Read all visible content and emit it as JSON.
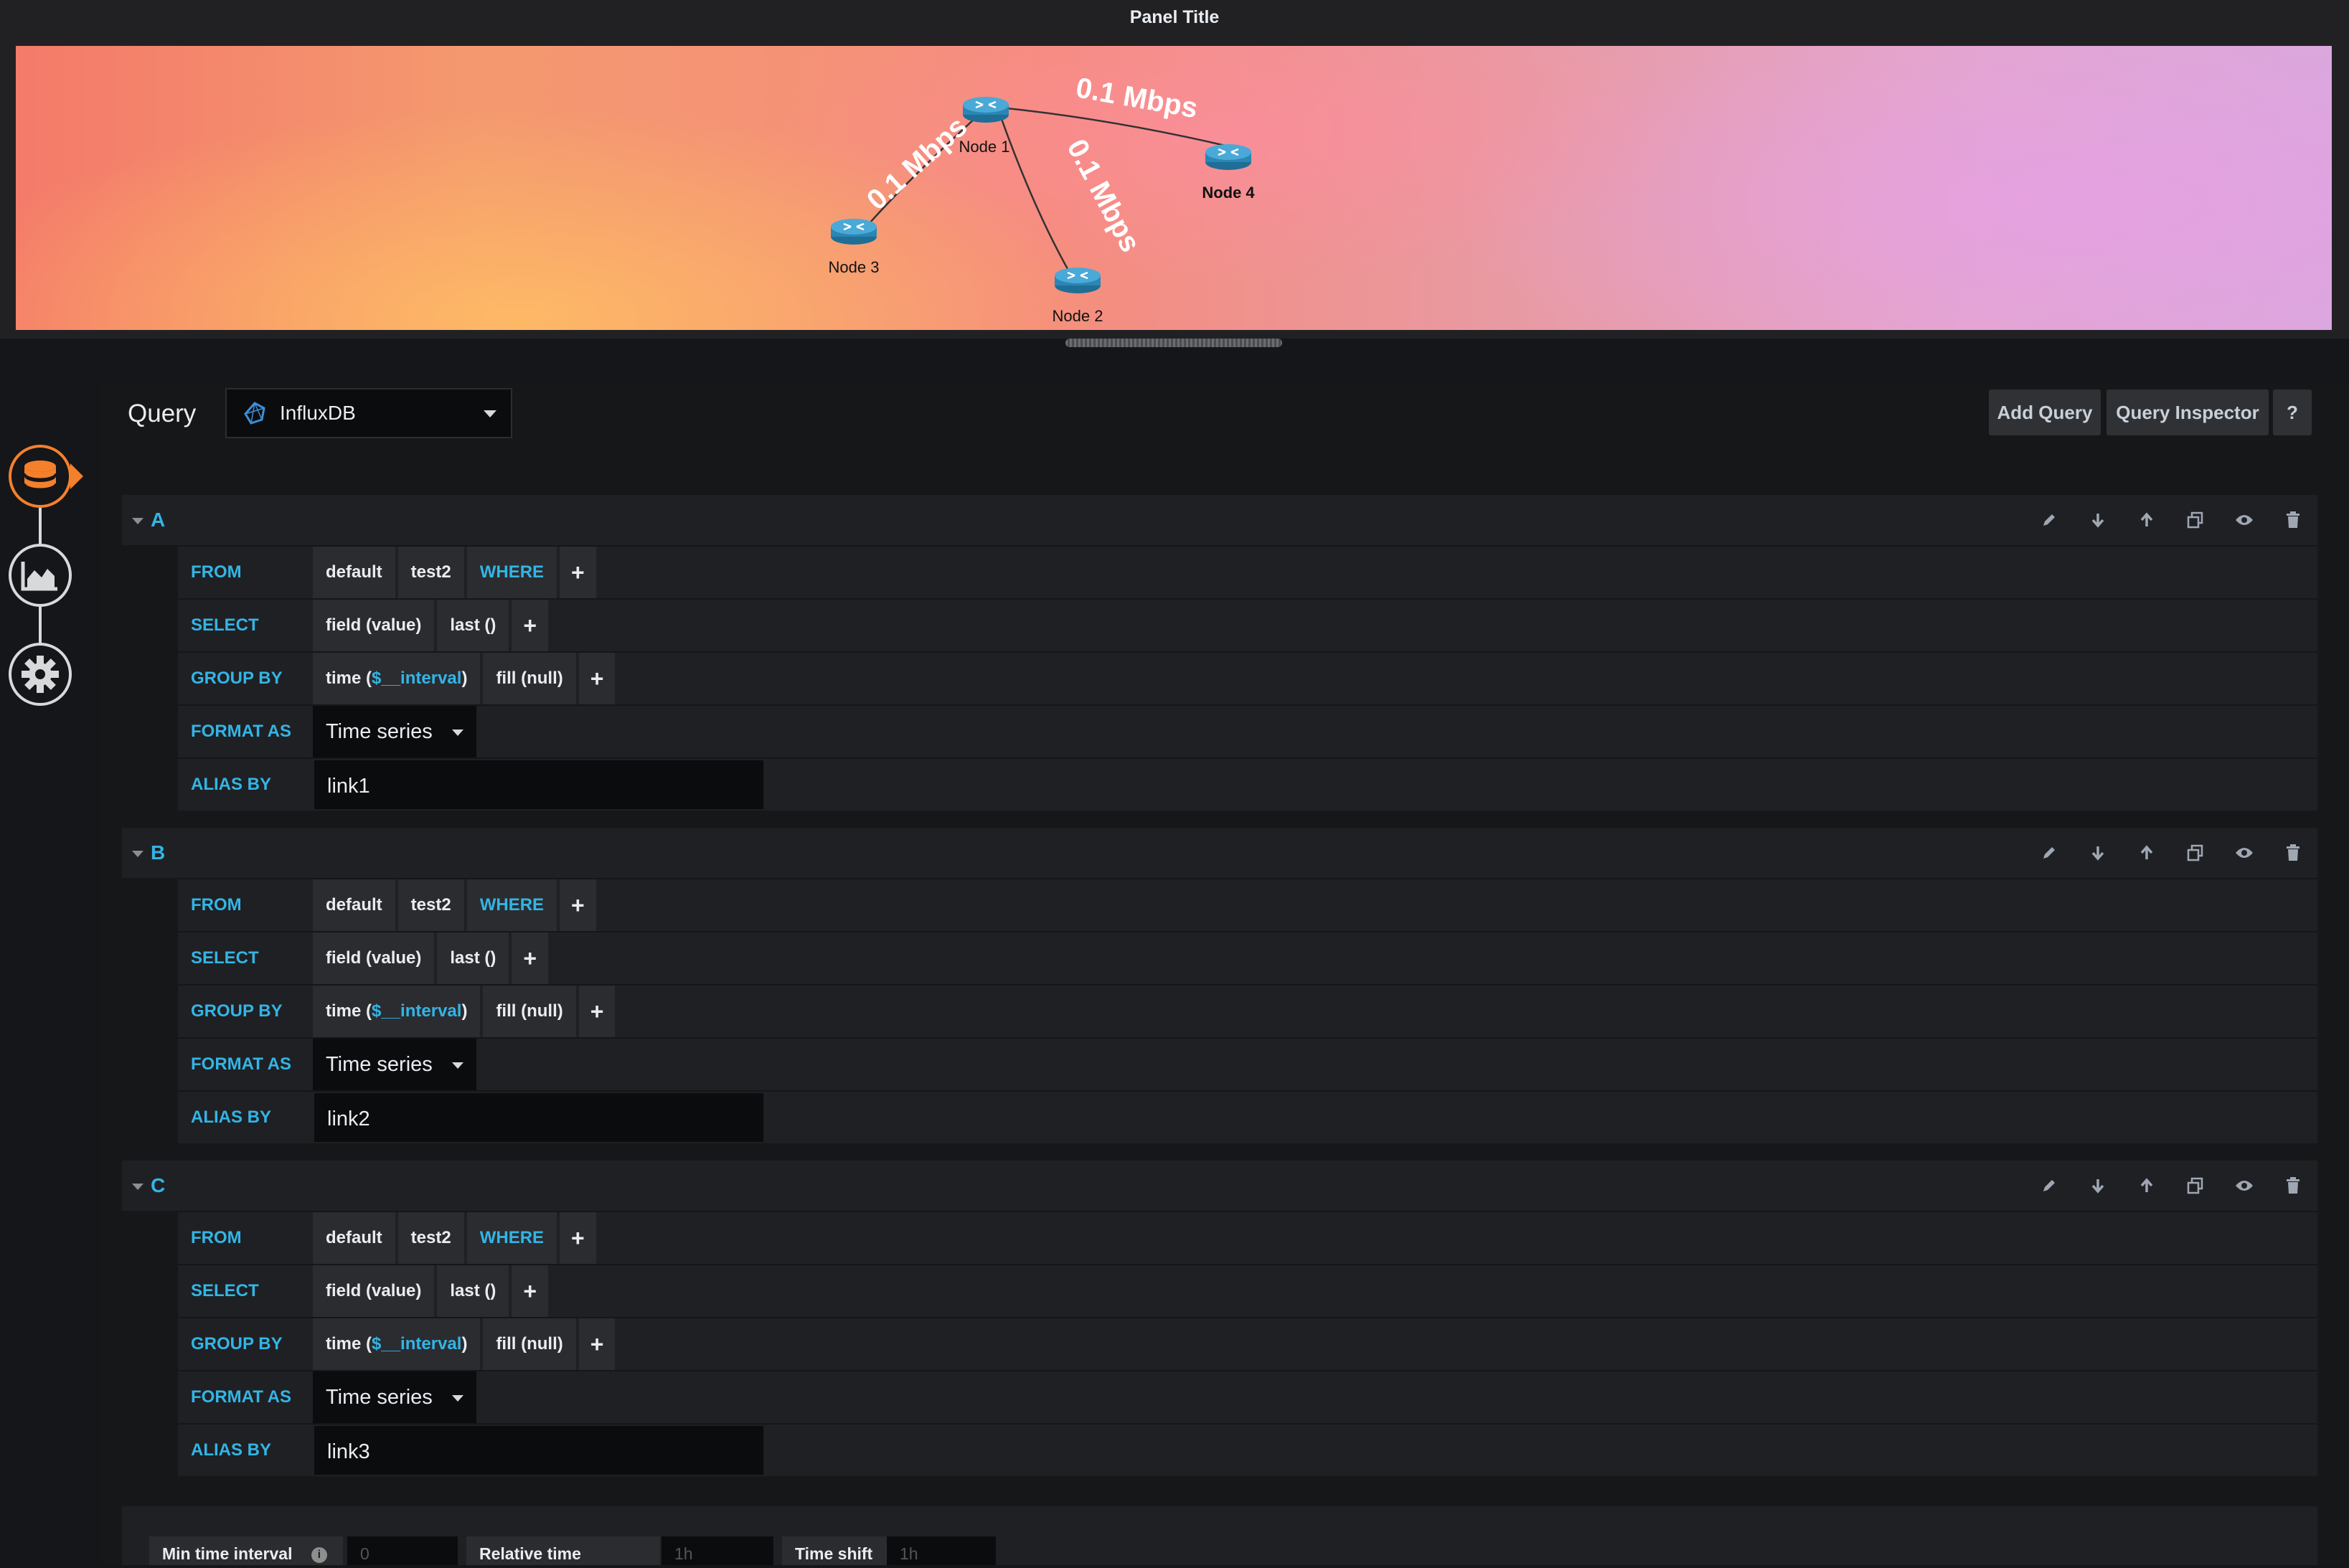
{
  "panel": {
    "title": "Panel Title",
    "nodes": [
      {
        "id": "n1",
        "label": "Node 1"
      },
      {
        "id": "n2",
        "label": "Node 2"
      },
      {
        "id": "n3",
        "label": "Node 3"
      },
      {
        "id": "n4",
        "label": "Node 4"
      }
    ],
    "links": [
      {
        "from": "n1",
        "to": "n4",
        "label": "0.1 Mbps"
      },
      {
        "from": "n1",
        "to": "n3",
        "label": "0.1 Mbps"
      },
      {
        "from": "n1",
        "to": "n2",
        "label": "0.1 Mbps"
      }
    ]
  },
  "rail": {
    "items": [
      {
        "name": "queries-tab",
        "icon": "database-icon",
        "active": true
      },
      {
        "name": "visualization-tab",
        "icon": "area-chart-icon",
        "active": false
      },
      {
        "name": "general-tab",
        "icon": "gear-icon",
        "active": false
      }
    ],
    "accent": "#f5802b"
  },
  "editor": {
    "label": "Query",
    "datasource": "InfluxDB",
    "add_query": "Add Query",
    "query_inspector": "Query Inspector",
    "help": "?"
  },
  "queries": [
    {
      "ref": "A",
      "from": {
        "keyword": "FROM",
        "policy": "default",
        "measurement": "test2",
        "where": "WHERE",
        "plus": "+"
      },
      "select": {
        "keyword": "SELECT",
        "field_prefix": "field",
        "field": "(value)",
        "fn": "last ()",
        "plus": "+"
      },
      "group": {
        "keyword": "GROUP BY",
        "time_prefix": "time (",
        "interval": "$__interval",
        "time_suffix": ")",
        "fill": "fill (null)",
        "plus": "+"
      },
      "format": {
        "keyword": "FORMAT AS",
        "value": "Time series"
      },
      "alias": {
        "keyword": "ALIAS BY",
        "value": "link1"
      }
    },
    {
      "ref": "B",
      "from": {
        "keyword": "FROM",
        "policy": "default",
        "measurement": "test2",
        "where": "WHERE",
        "plus": "+"
      },
      "select": {
        "keyword": "SELECT",
        "field_prefix": "field",
        "field": "(value)",
        "fn": "last ()",
        "plus": "+"
      },
      "group": {
        "keyword": "GROUP BY",
        "time_prefix": "time (",
        "interval": "$__interval",
        "time_suffix": ")",
        "fill": "fill (null)",
        "plus": "+"
      },
      "format": {
        "keyword": "FORMAT AS",
        "value": "Time series"
      },
      "alias": {
        "keyword": "ALIAS BY",
        "value": "link2"
      }
    },
    {
      "ref": "C",
      "from": {
        "keyword": "FROM",
        "policy": "default",
        "measurement": "test2",
        "where": "WHERE",
        "plus": "+"
      },
      "select": {
        "keyword": "SELECT",
        "field_prefix": "field",
        "field": "(value)",
        "fn": "last ()",
        "plus": "+"
      },
      "group": {
        "keyword": "GROUP BY",
        "time_prefix": "time (",
        "interval": "$__interval",
        "time_suffix": ")",
        "fill": "fill (null)",
        "plus": "+"
      },
      "format": {
        "keyword": "FORMAT AS",
        "value": "Time series"
      },
      "alias": {
        "keyword": "ALIAS BY",
        "value": "link3"
      }
    }
  ],
  "query_icons": [
    "pencil-icon",
    "arrow-down-icon",
    "arrow-up-icon",
    "duplicate-icon",
    "eye-icon",
    "trash-icon"
  ],
  "options": {
    "min_interval_label": "Min time interval",
    "min_interval_placeholder": "0",
    "relative_time_label": "Relative time",
    "relative_time_placeholder": "1h",
    "time_shift_label": "Time shift",
    "time_shift_placeholder": "1h"
  },
  "colors": {
    "keyword": "#33b5e5",
    "accent": "#f5802b",
    "router": "#2f8fbd"
  }
}
